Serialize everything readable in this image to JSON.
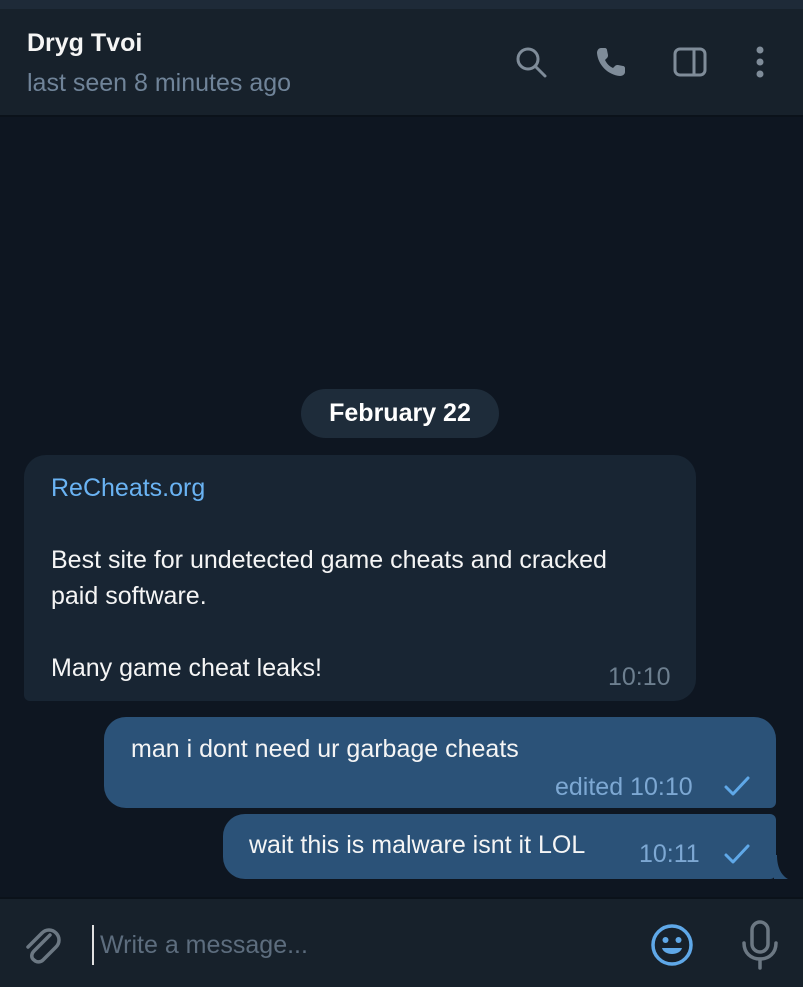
{
  "chat": {
    "title": "Dryg Tvoi",
    "status": "last seen 8 minutes ago"
  },
  "header_icons": [
    "search-icon",
    "phone-icon",
    "sidebar-toggle-icon",
    "more-vertical-icon"
  ],
  "date_separator": "February 22",
  "messages": [
    {
      "direction": "incoming",
      "link": "ReCheats.org",
      "lines": [
        "Best site for undetected game cheats and cracked",
        "paid software."
      ],
      "line_last": "Many game cheat leaks!",
      "time": "10:10"
    },
    {
      "direction": "outgoing",
      "text": "man i dont need ur garbage cheats",
      "meta": "edited 10:10",
      "status": "sent"
    },
    {
      "direction": "outgoing",
      "text": "wait this is malware isnt it LOL",
      "meta": "10:11",
      "status": "sent"
    }
  ],
  "composer": {
    "placeholder": "Write a message..."
  },
  "colors": {
    "background": "#0e1621",
    "panel": "#17212b",
    "incoming_bubble": "#182533",
    "outgoing_bubble": "#2b5278",
    "link": "#6ab3f3",
    "accent": "#5fa8e8"
  }
}
